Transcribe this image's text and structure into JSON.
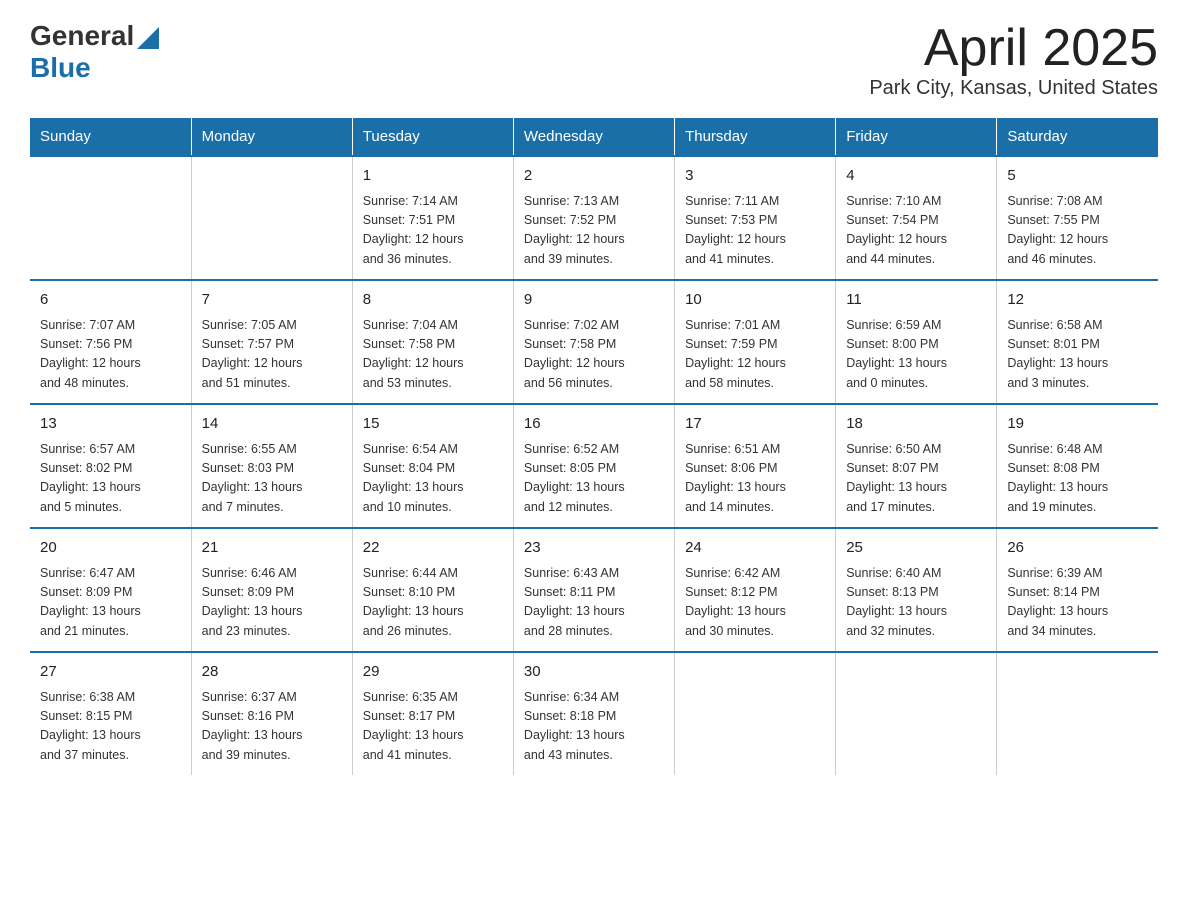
{
  "logo": {
    "general": "General",
    "blue": "Blue"
  },
  "title": "April 2025",
  "subtitle": "Park City, Kansas, United States",
  "days_of_week": [
    "Sunday",
    "Monday",
    "Tuesday",
    "Wednesday",
    "Thursday",
    "Friday",
    "Saturday"
  ],
  "weeks": [
    [
      {
        "day": "",
        "info": ""
      },
      {
        "day": "",
        "info": ""
      },
      {
        "day": "1",
        "info": "Sunrise: 7:14 AM\nSunset: 7:51 PM\nDaylight: 12 hours\nand 36 minutes."
      },
      {
        "day": "2",
        "info": "Sunrise: 7:13 AM\nSunset: 7:52 PM\nDaylight: 12 hours\nand 39 minutes."
      },
      {
        "day": "3",
        "info": "Sunrise: 7:11 AM\nSunset: 7:53 PM\nDaylight: 12 hours\nand 41 minutes."
      },
      {
        "day": "4",
        "info": "Sunrise: 7:10 AM\nSunset: 7:54 PM\nDaylight: 12 hours\nand 44 minutes."
      },
      {
        "day": "5",
        "info": "Sunrise: 7:08 AM\nSunset: 7:55 PM\nDaylight: 12 hours\nand 46 minutes."
      }
    ],
    [
      {
        "day": "6",
        "info": "Sunrise: 7:07 AM\nSunset: 7:56 PM\nDaylight: 12 hours\nand 48 minutes."
      },
      {
        "day": "7",
        "info": "Sunrise: 7:05 AM\nSunset: 7:57 PM\nDaylight: 12 hours\nand 51 minutes."
      },
      {
        "day": "8",
        "info": "Sunrise: 7:04 AM\nSunset: 7:58 PM\nDaylight: 12 hours\nand 53 minutes."
      },
      {
        "day": "9",
        "info": "Sunrise: 7:02 AM\nSunset: 7:58 PM\nDaylight: 12 hours\nand 56 minutes."
      },
      {
        "day": "10",
        "info": "Sunrise: 7:01 AM\nSunset: 7:59 PM\nDaylight: 12 hours\nand 58 minutes."
      },
      {
        "day": "11",
        "info": "Sunrise: 6:59 AM\nSunset: 8:00 PM\nDaylight: 13 hours\nand 0 minutes."
      },
      {
        "day": "12",
        "info": "Sunrise: 6:58 AM\nSunset: 8:01 PM\nDaylight: 13 hours\nand 3 minutes."
      }
    ],
    [
      {
        "day": "13",
        "info": "Sunrise: 6:57 AM\nSunset: 8:02 PM\nDaylight: 13 hours\nand 5 minutes."
      },
      {
        "day": "14",
        "info": "Sunrise: 6:55 AM\nSunset: 8:03 PM\nDaylight: 13 hours\nand 7 minutes."
      },
      {
        "day": "15",
        "info": "Sunrise: 6:54 AM\nSunset: 8:04 PM\nDaylight: 13 hours\nand 10 minutes."
      },
      {
        "day": "16",
        "info": "Sunrise: 6:52 AM\nSunset: 8:05 PM\nDaylight: 13 hours\nand 12 minutes."
      },
      {
        "day": "17",
        "info": "Sunrise: 6:51 AM\nSunset: 8:06 PM\nDaylight: 13 hours\nand 14 minutes."
      },
      {
        "day": "18",
        "info": "Sunrise: 6:50 AM\nSunset: 8:07 PM\nDaylight: 13 hours\nand 17 minutes."
      },
      {
        "day": "19",
        "info": "Sunrise: 6:48 AM\nSunset: 8:08 PM\nDaylight: 13 hours\nand 19 minutes."
      }
    ],
    [
      {
        "day": "20",
        "info": "Sunrise: 6:47 AM\nSunset: 8:09 PM\nDaylight: 13 hours\nand 21 minutes."
      },
      {
        "day": "21",
        "info": "Sunrise: 6:46 AM\nSunset: 8:09 PM\nDaylight: 13 hours\nand 23 minutes."
      },
      {
        "day": "22",
        "info": "Sunrise: 6:44 AM\nSunset: 8:10 PM\nDaylight: 13 hours\nand 26 minutes."
      },
      {
        "day": "23",
        "info": "Sunrise: 6:43 AM\nSunset: 8:11 PM\nDaylight: 13 hours\nand 28 minutes."
      },
      {
        "day": "24",
        "info": "Sunrise: 6:42 AM\nSunset: 8:12 PM\nDaylight: 13 hours\nand 30 minutes."
      },
      {
        "day": "25",
        "info": "Sunrise: 6:40 AM\nSunset: 8:13 PM\nDaylight: 13 hours\nand 32 minutes."
      },
      {
        "day": "26",
        "info": "Sunrise: 6:39 AM\nSunset: 8:14 PM\nDaylight: 13 hours\nand 34 minutes."
      }
    ],
    [
      {
        "day": "27",
        "info": "Sunrise: 6:38 AM\nSunset: 8:15 PM\nDaylight: 13 hours\nand 37 minutes."
      },
      {
        "day": "28",
        "info": "Sunrise: 6:37 AM\nSunset: 8:16 PM\nDaylight: 13 hours\nand 39 minutes."
      },
      {
        "day": "29",
        "info": "Sunrise: 6:35 AM\nSunset: 8:17 PM\nDaylight: 13 hours\nand 41 minutes."
      },
      {
        "day": "30",
        "info": "Sunrise: 6:34 AM\nSunset: 8:18 PM\nDaylight: 13 hours\nand 43 minutes."
      },
      {
        "day": "",
        "info": ""
      },
      {
        "day": "",
        "info": ""
      },
      {
        "day": "",
        "info": ""
      }
    ]
  ]
}
